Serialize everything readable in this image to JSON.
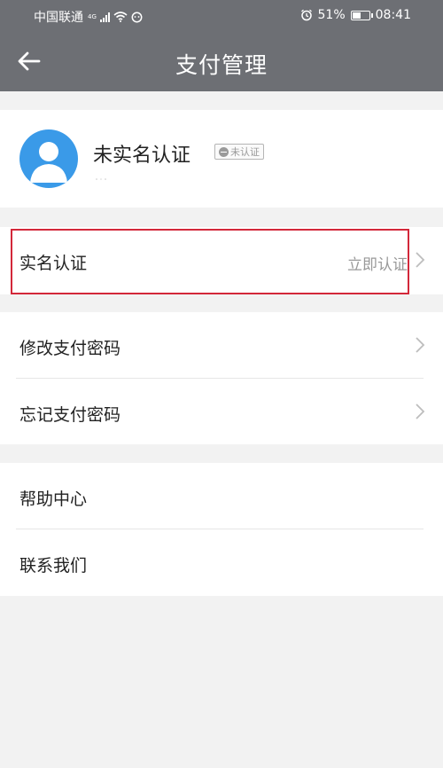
{
  "status_bar": {
    "carrier": "中国联通",
    "network": "4G",
    "battery": "51%",
    "time": "08:41",
    "icons": [
      "signal-icon",
      "wifi-icon",
      "message-icon",
      "alarm-icon",
      "battery-icon"
    ]
  },
  "header": {
    "title": "支付管理",
    "back_icon": "arrow-left-icon"
  },
  "profile": {
    "name": "未实名认证",
    "badge": "未认证",
    "avatar_icon": "user-avatar-icon"
  },
  "menu": {
    "real_name": {
      "label": "实名认证",
      "value": "立即认证"
    },
    "change_password": {
      "label": "修改支付密码"
    },
    "forgot_password": {
      "label": "忘记支付密码"
    },
    "help": {
      "label": "帮助中心"
    },
    "contact": {
      "label": "联系我们"
    }
  },
  "colors": {
    "header_bg": "#6d6f74",
    "avatar_bg": "#3a9ae8",
    "highlight_border": "#d3283a",
    "page_bg": "#f2f2f2"
  }
}
